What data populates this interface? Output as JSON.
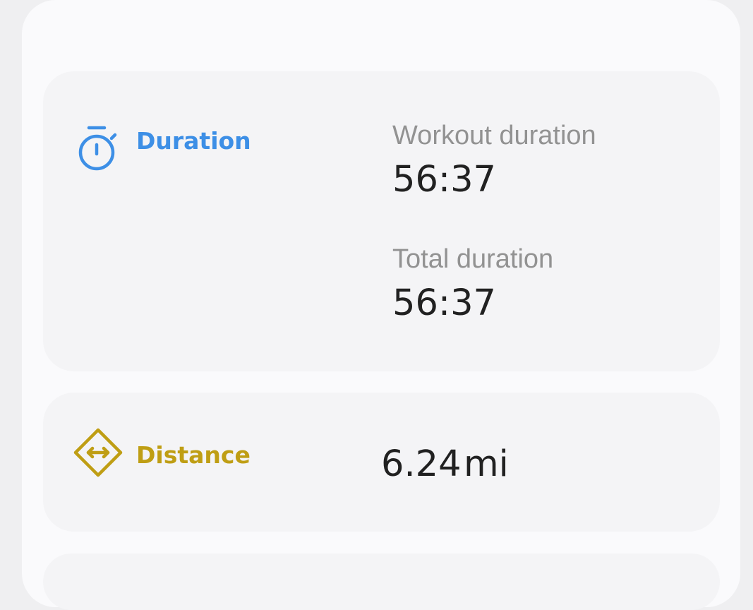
{
  "colors": {
    "duration_accent": "#3d8fe6",
    "distance_accent": "#bf9e14",
    "label_gray": "#929292",
    "value_dark": "#212121"
  },
  "duration": {
    "icon": "stopwatch-icon",
    "title": "Duration",
    "workout_label": "Workout duration",
    "workout_value": "56:37",
    "total_label": "Total duration",
    "total_value": "56:37"
  },
  "distance": {
    "icon": "distance-diamond-icon",
    "title": "Distance",
    "value": "6.24",
    "unit": "mi"
  }
}
